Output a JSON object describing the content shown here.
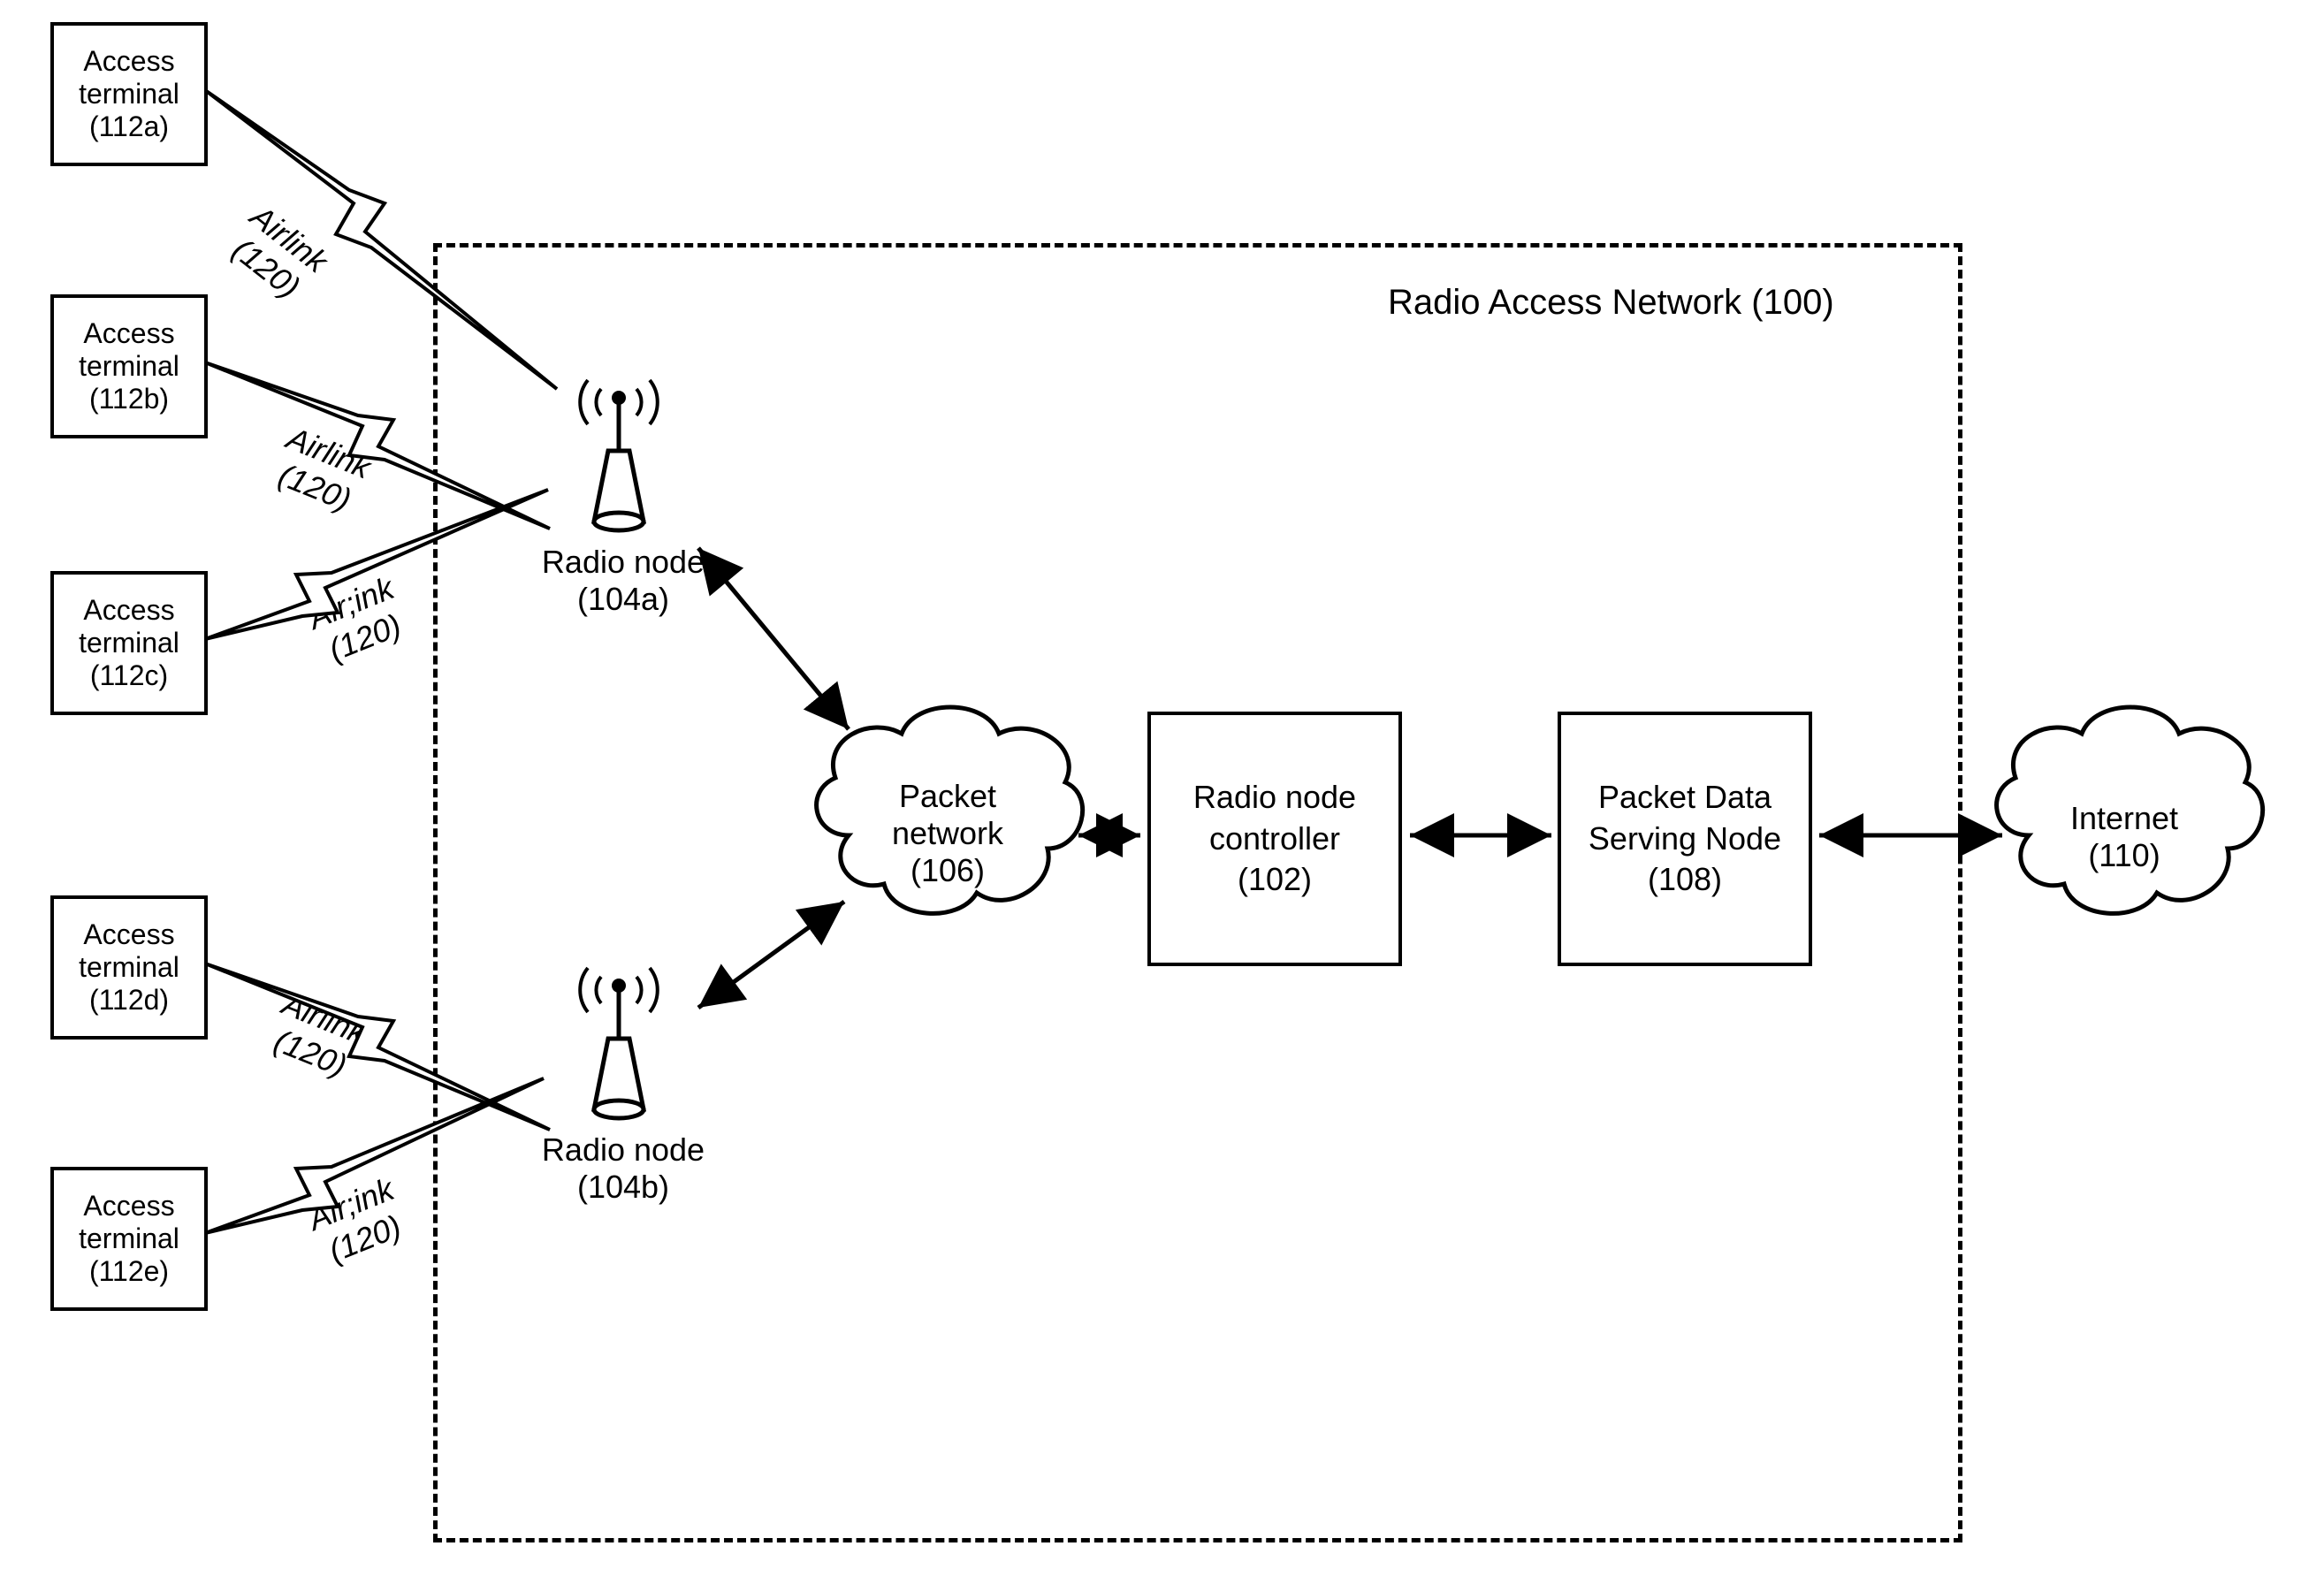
{
  "title": "Radio Access Network (100)",
  "terminals": {
    "a": {
      "name": "Access terminal",
      "id": "(112a)"
    },
    "b": {
      "name": "Access terminal",
      "id": "(112b)"
    },
    "c": {
      "name": "Access terminal",
      "id": "(112c)"
    },
    "d": {
      "name": "Access terminal",
      "id": "(112d)"
    },
    "e": {
      "name": "Access terminal",
      "id": "(112e)"
    }
  },
  "airlinks": {
    "a": {
      "name": "Airlink",
      "id": "(120)"
    },
    "b": {
      "name": "Airlink",
      "id": "(120)"
    },
    "c": {
      "name": "Air;ink",
      "id": "(120)"
    },
    "d": {
      "name": "Airlink",
      "id": "(120)"
    },
    "e": {
      "name": "Air;ink",
      "id": "(120)"
    }
  },
  "radio_nodes": {
    "a": {
      "name": "Radio node",
      "id": "(104a)"
    },
    "b": {
      "name": "Radio node",
      "id": "(104b)"
    }
  },
  "packet_network": {
    "name": "Packet network",
    "id": "(106)"
  },
  "rnc": {
    "name": "Radio node controller",
    "id": "(102)"
  },
  "pdsn": {
    "name": "Packet Data Serving Node",
    "id": "(108)"
  },
  "internet": {
    "name": "Internet",
    "id": "(110)"
  }
}
